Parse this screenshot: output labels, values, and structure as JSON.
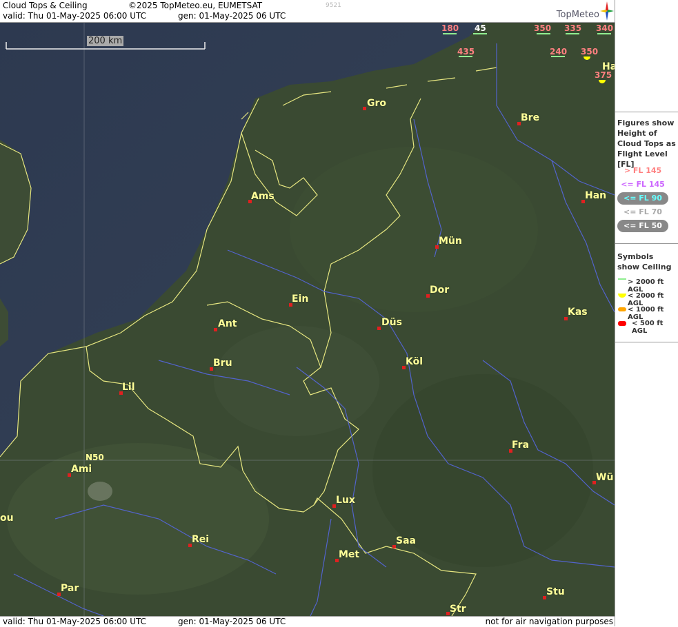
{
  "header": {
    "title": "Cloud Tops & Ceiling",
    "copyright": "©2025 TopMeteo.eu, EUMETSAT",
    "code": "9521",
    "valid": "valid:  Thu  01-May-2025  06:00 UTC",
    "gen": "gen: 01-May-2025 06 UTC",
    "logo_text": "TopMeteo"
  },
  "map": {
    "scale_label": "200 km",
    "grid_label": "N50",
    "cities": [
      {
        "name": "Gro"
      },
      {
        "name": "Bre"
      },
      {
        "name": "Ams"
      },
      {
        "name": "Han"
      },
      {
        "name": "Mün"
      },
      {
        "name": "Ein"
      },
      {
        "name": "Dor"
      },
      {
        "name": "Ant"
      },
      {
        "name": "Düs"
      },
      {
        "name": "Kas"
      },
      {
        "name": "Bru"
      },
      {
        "name": "Köl"
      },
      {
        "name": "Lil"
      },
      {
        "name": "Fra"
      },
      {
        "name": "Ami"
      },
      {
        "name": "Wü"
      },
      {
        "name": "ou"
      },
      {
        "name": "Lux"
      },
      {
        "name": "Rei"
      },
      {
        "name": "Saa"
      },
      {
        "name": "Met"
      },
      {
        "name": "Par"
      },
      {
        "name": "Stu"
      },
      {
        "name": "Str"
      },
      {
        "name": "Ha"
      }
    ],
    "flight_levels": [
      {
        "value": "180",
        "color": "#ff8080"
      },
      {
        "value": "45",
        "color": "#ffffff"
      },
      {
        "value": "350",
        "color": "#ff8080"
      },
      {
        "value": "335",
        "color": "#ff8080"
      },
      {
        "value": "340",
        "color": "#ff8080"
      },
      {
        "value": "435",
        "color": "#ff8080"
      },
      {
        "value": "240",
        "color": "#ff8080"
      },
      {
        "value": "350",
        "color": "#ff8080"
      },
      {
        "value": "375",
        "color": "#ff8080"
      }
    ]
  },
  "legend": {
    "heights_title": "Figures show Height of Cloud Tops as Flight Level  [FL]",
    "heights": [
      {
        "label": "> FL 145",
        "color": "#ff8080"
      },
      {
        "label": "<= FL 145",
        "color": "#cc66ff"
      },
      {
        "label": "<= FL 90",
        "color": "#66ffff"
      },
      {
        "label": "<= FL 70",
        "color": "#aaaaaa"
      },
      {
        "label": "<= FL 50",
        "color": "#ffffff"
      }
    ],
    "symbols_title": "Symbols show Ceiling",
    "symbols": [
      {
        "label": "> 2000 ft AGL",
        "color": "#90ee90"
      },
      {
        "label": "< 2000 ft AGL",
        "color": "#ffff00"
      },
      {
        "label": "< 1000 ft AGL",
        "color": "#ffa500"
      },
      {
        "label": "< 500 ft AGL",
        "color": "#ff0000"
      }
    ]
  },
  "footer": {
    "valid": "valid:  Thu  01-May-2025  06:00 UTC",
    "gen": "gen: 01-May-2025 06 UTC",
    "notice": "not for air navigation purposes"
  }
}
